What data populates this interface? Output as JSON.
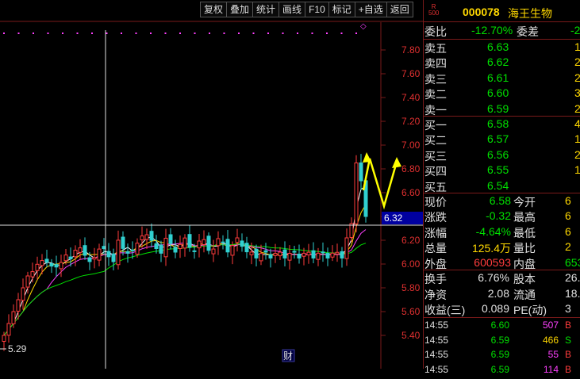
{
  "toolbar": {
    "buttons": [
      "复权",
      "叠加",
      "统计",
      "画线",
      "F10",
      "标记",
      "+自选",
      "返回"
    ]
  },
  "chart": {
    "y_ticks": [
      "7.80",
      "7.60",
      "7.40",
      "7.20",
      "7.00",
      "6.80",
      "6.60",
      "6.40",
      "6.20",
      "6.00",
      "5.80",
      "5.60",
      "5.40"
    ],
    "price_tag": "6.32",
    "low_label": "5.29",
    "finance_badge": "财",
    "diamond": "◇"
  },
  "colors": {
    "candle_up": "#ff3c3c",
    "candle_down": "#30d0d0",
    "ma_white": "#ffffff",
    "ma_yellow": "#ffd800",
    "ma_magenta": "#ff40ff",
    "ma_green": "#00e000",
    "arrow": "#ffff00"
  },
  "quote": {
    "badge_top": "R",
    "badge_bottom": "500",
    "code": "000078",
    "name": "海王生物",
    "weibi_label": "委比",
    "weibi_value": "-12.70%",
    "weicha_label": "委差",
    "weicha_value": "-2",
    "asks": [
      {
        "label": "卖五",
        "price": "6.63",
        "vol": "1"
      },
      {
        "label": "卖四",
        "price": "6.62",
        "vol": "2"
      },
      {
        "label": "卖三",
        "price": "6.61",
        "vol": "2"
      },
      {
        "label": "卖二",
        "price": "6.60",
        "vol": "3"
      },
      {
        "label": "卖一",
        "price": "6.59",
        "vol": "2"
      }
    ],
    "bids": [
      {
        "label": "买一",
        "price": "6.58",
        "vol": "4"
      },
      {
        "label": "买二",
        "price": "6.57",
        "vol": "1"
      },
      {
        "label": "买三",
        "price": "6.56",
        "vol": "2"
      },
      {
        "label": "买四",
        "price": "6.55",
        "vol": "1"
      },
      {
        "label": "买五",
        "price": "6.54",
        "vol": ""
      }
    ],
    "stats": [
      {
        "l1": "现价",
        "v1": "6.58",
        "l2": "今开",
        "v2": "6"
      },
      {
        "l1": "涨跌",
        "v1": "-0.32",
        "l2": "最高",
        "v2": "6"
      },
      {
        "l1": "涨幅",
        "v1": "-4.64%",
        "l2": "最低",
        "v2": "6"
      },
      {
        "l1": "总量",
        "v1": "125.4万",
        "l2": "量比",
        "v2": "2"
      },
      {
        "l1": "外盘",
        "v1": "600593",
        "l2": "内盘",
        "v2": "653"
      }
    ],
    "fundamentals": [
      {
        "l1": "换手",
        "v1": "6.76%",
        "l2": "股本",
        "v2": "26."
      },
      {
        "l1": "净资",
        "v1": "2.08",
        "l2": "流通",
        "v2": "18."
      },
      {
        "l1": "收益(三)",
        "v1": "0.089",
        "l2": "PE(动)",
        "v2": "3"
      }
    ],
    "ticks": [
      {
        "time": "14:55",
        "price": "6.60",
        "vol": "507",
        "side": "B"
      },
      {
        "time": "14:55",
        "price": "6.59",
        "vol": "466",
        "side": "S"
      },
      {
        "time": "14:55",
        "price": "6.59",
        "vol": "55",
        "side": "B"
      },
      {
        "time": "14:55",
        "price": "6.59",
        "vol": "114",
        "side": "B"
      }
    ]
  }
}
